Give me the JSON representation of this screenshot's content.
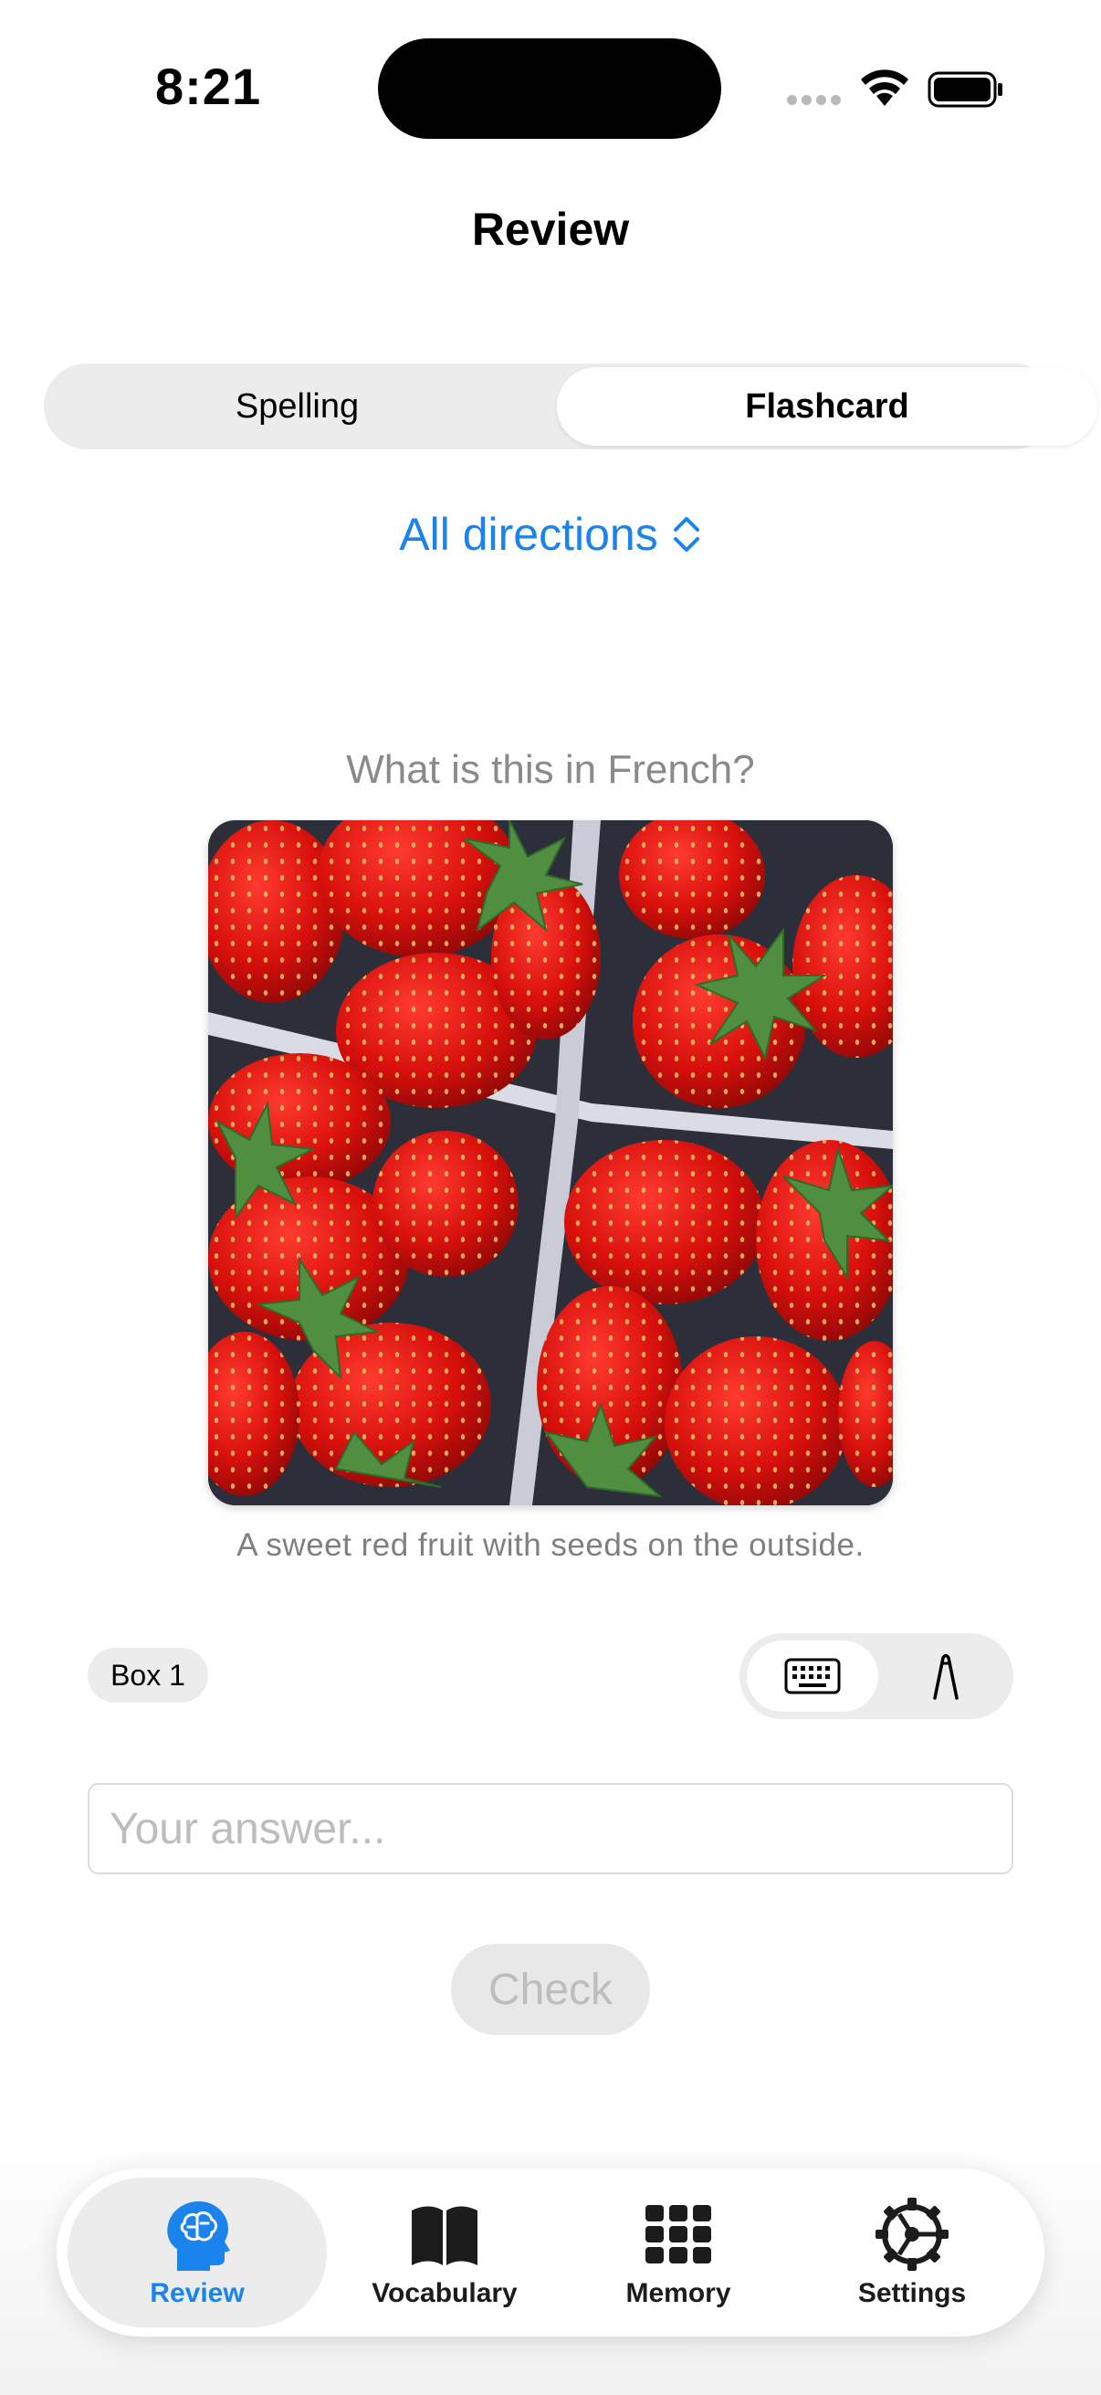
{
  "status_bar": {
    "time": "8:21"
  },
  "nav": {
    "title": "Review"
  },
  "mode_picker": {
    "options": [
      "Spelling",
      "Flashcard"
    ],
    "selected": "Flashcard"
  },
  "direction": {
    "label": "All directions"
  },
  "card": {
    "prompt": "What is this in French?",
    "hint": "A sweet red fruit with seeds on the outside."
  },
  "box": {
    "label": "Box 1"
  },
  "input_mode": {
    "options": [
      "keyboard-icon",
      "pen-icon"
    ],
    "selected": "keyboard-icon"
  },
  "answer": {
    "placeholder": "Your answer...",
    "value": ""
  },
  "check_button": {
    "label": "Check",
    "enabled": false
  },
  "tabs": [
    {
      "label": "Review",
      "icon": "brain-head-icon",
      "active": true
    },
    {
      "label": "Vocabulary",
      "icon": "book-icon",
      "active": false
    },
    {
      "label": "Memory",
      "icon": "grid-icon",
      "active": false
    },
    {
      "label": "Settings",
      "icon": "gear-icon",
      "active": false
    }
  ],
  "colors": {
    "accent": "#1a84ec",
    "segment_bg": "#ececec",
    "muted_text": "#8a8a8a"
  }
}
